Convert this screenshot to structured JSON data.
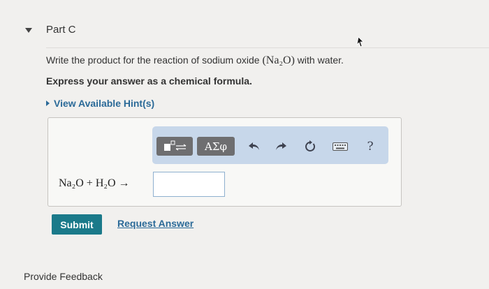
{
  "part": {
    "title": "Part C"
  },
  "question": {
    "text_before": "Write the product for the reaction of sodium oxide ",
    "formula": "(Na₂O)",
    "text_after": " with water.",
    "instructions": "Express your answer as a chemical formula."
  },
  "hint": {
    "label": "View Available Hint(s)"
  },
  "toolbar": {
    "greek_label": "ΑΣφ",
    "help_label": "?",
    "icons": [
      "templates-icon",
      "greek-letters-icon",
      "undo-icon",
      "redo-icon",
      "reset-icon",
      "keyboard-icon",
      "help-icon"
    ]
  },
  "equation": {
    "text": "Na₂O + H₂O →"
  },
  "answer": {
    "value": ""
  },
  "actions": {
    "submit_label": "Submit",
    "request_label": "Request Answer"
  },
  "footer": {
    "feedback_label": "Provide Feedback"
  }
}
